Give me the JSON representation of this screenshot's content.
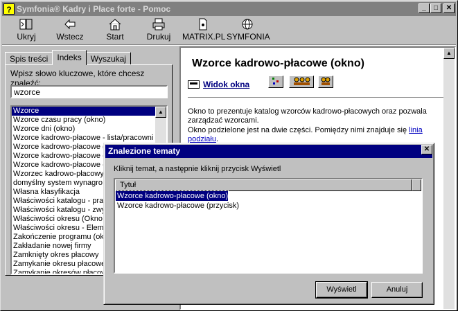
{
  "window": {
    "title": "Symfonia® Kadry i Płace forte - Pomoc",
    "app_icon": "?",
    "minimize": "_",
    "maximize": "□",
    "close": "✕"
  },
  "toolbar": {
    "items": [
      {
        "label": "Ukryj",
        "icon": "hide-icon"
      },
      {
        "label": "Wstecz",
        "icon": "back-arrow-icon"
      },
      {
        "label": "Start",
        "icon": "home-icon"
      },
      {
        "label": "Drukuj",
        "icon": "printer-icon"
      },
      {
        "label": "MATRIX.PL",
        "icon": "document-icon"
      },
      {
        "label": "SYMFONIA",
        "icon": "globe-icon"
      }
    ]
  },
  "left": {
    "tabs": [
      {
        "label": "Spis treści"
      },
      {
        "label": "Indeks"
      },
      {
        "label": "Wyszukaj"
      }
    ],
    "prompt": "Wpisz słowo kluczowe, które chcesz znaleźć:",
    "search_value": "wzorce",
    "items": [
      "Wzorce",
      "Wzorce czasu pracy (okno)",
      "Wzorce dni (okno)",
      "Wzorce kadrowo-płacowe  - lista/pracowni",
      "Wzorce kadrowo-płacowe (",
      "Wzorce kadrowo-płacowe -",
      "Wzorce kadrowo-płacowe -",
      "Wzorzec kadrowo-płacowy",
      "   domyślny system wynagro",
      "Własna klasyfikacja",
      "Właściwości katalogu - prac",
      "Właściwości katalogu - zwy",
      "Właściwości okresu (Okno",
      "Właściwości okresu - Eleme",
      "Zakończenie programu (okn",
      "Zakładanie nowej firmy",
      "Zamknięty okres płacowy",
      "Zamykanie okresu płacowe",
      "Zamykanie okresów płacow"
    ]
  },
  "content": {
    "heading": "Wzorce kadrowo-płacowe (okno)",
    "view_link": "Widok okna",
    "para1": "Okno to prezentuje katalog wzorców kadrowo-płacowych oraz pozwala zarządzać wzorcami.",
    "para2_text": "Okno podzielone jest na dwie części. Pomiędzy nimi znajduje się ",
    "para2_link": "linia podziału",
    "para2_end": "."
  },
  "dialog": {
    "title": "Znalezione tematy",
    "close": "✕",
    "instruction": "Kliknij temat, a następnie kliknij przycisk Wyświetl",
    "column_header": "Tytuł",
    "topics": [
      "Wzorce kadrowo-płacowe (okno)",
      "Wzorce kadrowo-płacowe (przycisk)"
    ],
    "ok_label": "Wyświetl",
    "cancel_label": "Anuluj"
  },
  "colors": {
    "dialog_title_bg": "#000080",
    "selection_bg": "#000080",
    "link": "#0000c0"
  }
}
